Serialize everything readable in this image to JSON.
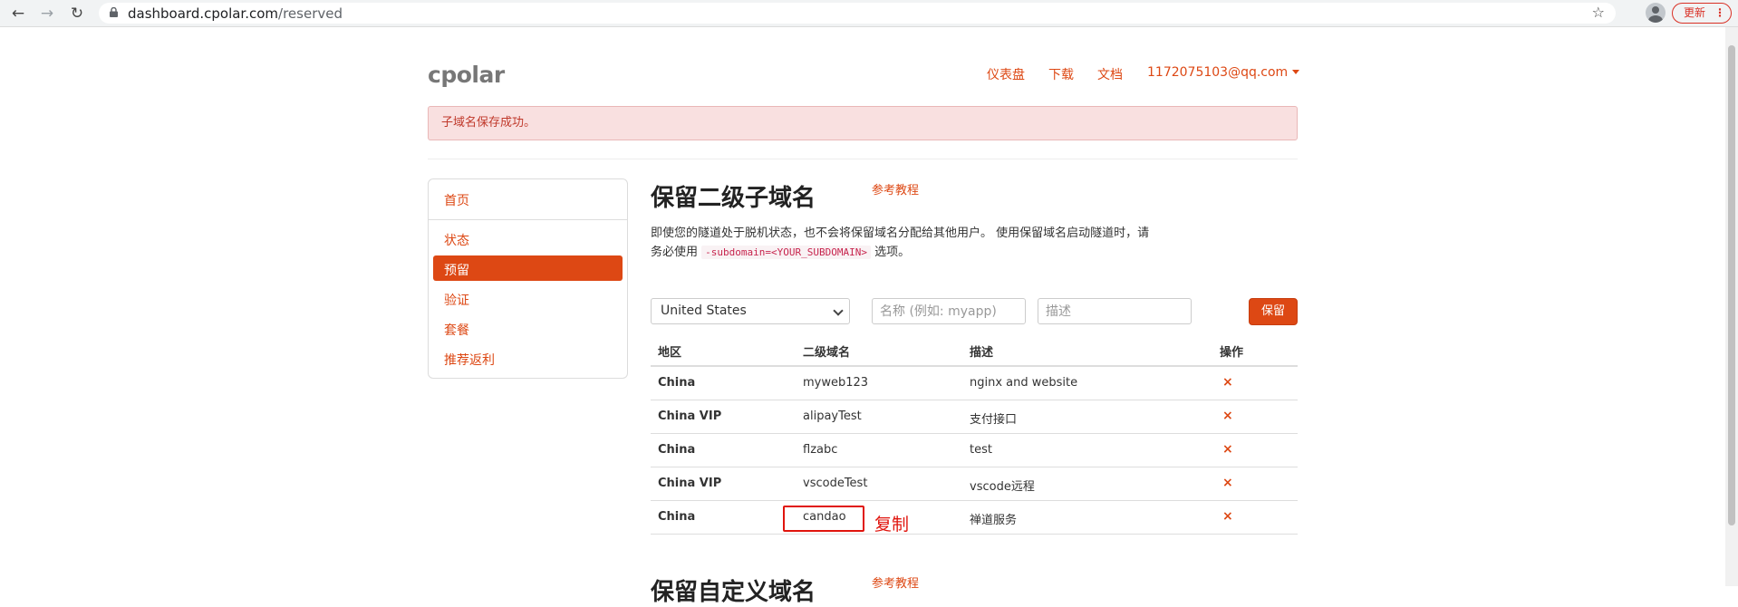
{
  "browser": {
    "url_host": "dashboard.cpolar.com",
    "url_path": "/reserved",
    "update_label": "更新"
  },
  "brand": "cpolar",
  "nav": {
    "dashboard": "仪表盘",
    "download": "下载",
    "docs": "文档",
    "account": "1172075103@qq.com"
  },
  "alert": "子域名保存成功。",
  "sidebar": {
    "items": [
      {
        "label": "首页"
      },
      {
        "label": "状态"
      },
      {
        "label": "预留"
      },
      {
        "label": "验证"
      },
      {
        "label": "套餐"
      },
      {
        "label": "推荐返利"
      }
    ],
    "active": "预留"
  },
  "main": {
    "title": "保留二级子域名",
    "ref_link": "参考教程",
    "desc_before": "即使您的隧道处于脱机状态，也不会将保留域名分配给其他用户。 使用保留域名启动隧道时，请务必使用",
    "desc_code": "-subdomain=<YOUR_SUBDOMAIN>",
    "desc_after": "选项。",
    "form": {
      "region_selected": "United States",
      "name_placeholder": "名称 (例如: myapp)",
      "desc_placeholder": "描述",
      "save_label": "保留"
    },
    "table": {
      "headers": [
        "地区",
        "二级域名",
        "描述",
        "操作"
      ],
      "rows": [
        {
          "region": "China",
          "subdomain": "myweb123",
          "description": "nginx and website",
          "action": "×"
        },
        {
          "region": "China VIP",
          "subdomain": "alipayTest",
          "description": "支付接口",
          "action": "×"
        },
        {
          "region": "China",
          "subdomain": "flzabc",
          "description": "test",
          "action": "×"
        },
        {
          "region": "China VIP",
          "subdomain": "vscodeTest",
          "description": "vscode远程",
          "action": "×"
        },
        {
          "region": "China",
          "subdomain": "candao",
          "description": "禅道服务",
          "action": "×"
        }
      ]
    },
    "annotation": "复制"
  },
  "next_section": {
    "title": "保留自定义域名",
    "ref_link": "参考教程"
  },
  "colors": {
    "accent": "#dd4814",
    "alert_bg": "#f9e0e0",
    "annotation": "#e0140d"
  }
}
